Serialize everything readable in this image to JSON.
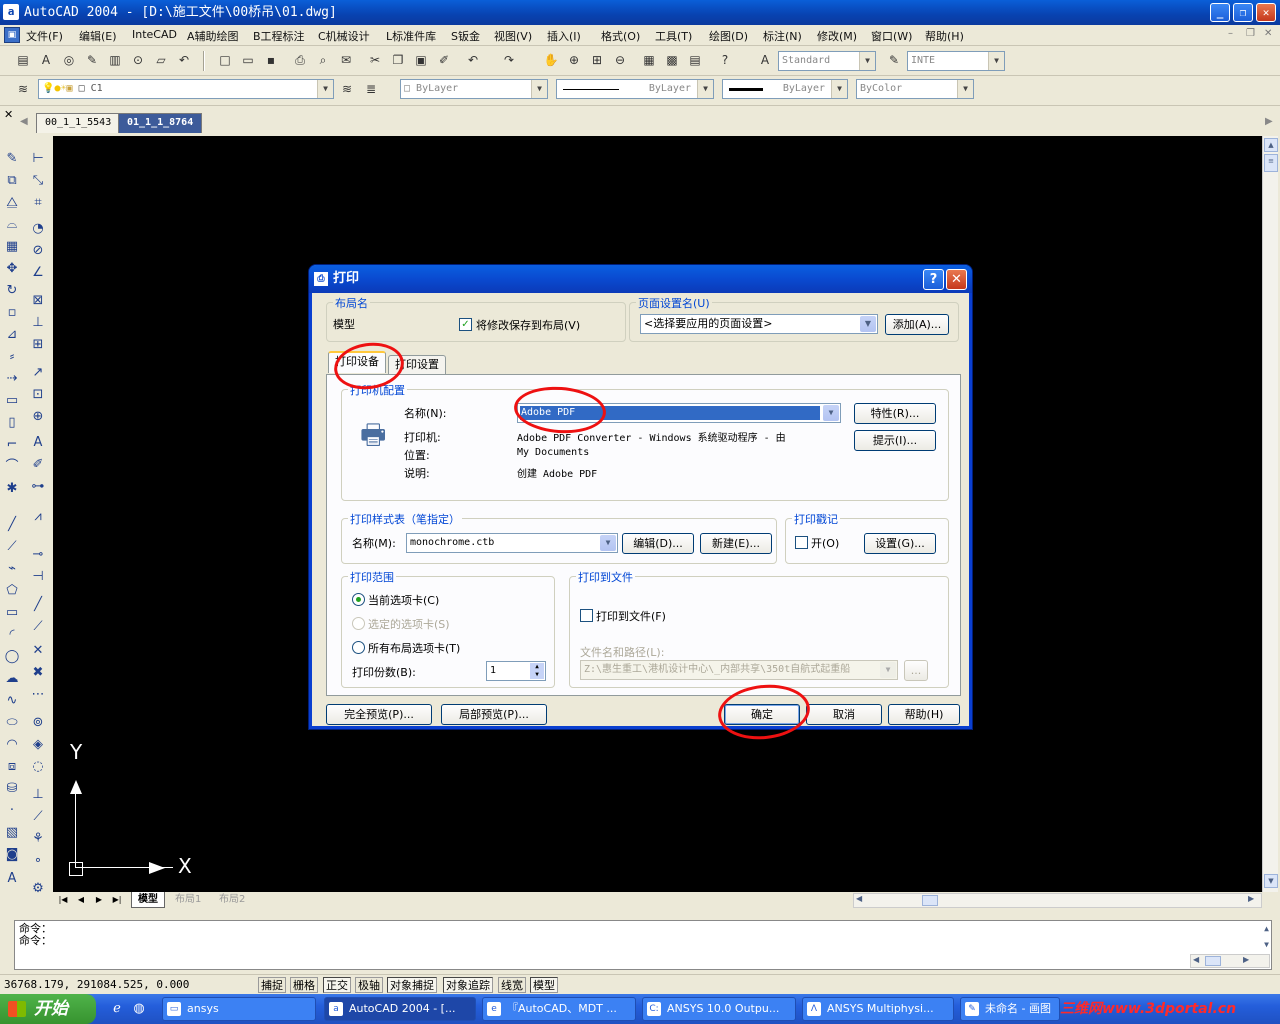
{
  "window": {
    "title": "AutoCAD 2004 - [D:\\施工文件\\00桥吊\\01.dwg]",
    "app_icon": "a",
    "minimize": "_",
    "restore": "❐",
    "close": "✕"
  },
  "menu": {
    "items": [
      "文件(F)",
      "编辑(E)",
      "InteCAD",
      "A辅助绘图",
      "B工程标注",
      "C机械设计",
      "L标准件库",
      "S钣金",
      "视图(V)",
      "插入(I)",
      "格式(O)",
      "工具(T)",
      "绘图(D)",
      "标注(N)",
      "修改(M)",
      "窗口(W)",
      "帮助(H)"
    ],
    "mdi_controls": [
      "–",
      "❐",
      "✕"
    ]
  },
  "toolbar": {
    "textstyle": "Standard",
    "dimstyle": "INTE",
    "layer": "C1",
    "color": "ByLayer",
    "linetype": "ByLayer",
    "lineweight": "ByLayer",
    "plotstyle": "ByColor"
  },
  "doc_tabs": [
    "00_1_1_5543",
    "01_1_1_8764"
  ],
  "layout_tabs": [
    "模型",
    "布局1",
    "布局2"
  ],
  "ucs": {
    "y": "Y",
    "x": "X"
  },
  "command": {
    "line1": "命令：",
    "line2": "命令："
  },
  "status": {
    "coords": "36768.179,  291084.525, 0.000",
    "buttons": [
      "捕捉",
      "栅格",
      "正交",
      "极轴",
      "对象捕捉",
      "对象追踪",
      "线宽",
      "模型"
    ]
  },
  "taskbar": {
    "start": "开始",
    "tasks": [
      "ansys",
      "AutoCAD 2004 - [...",
      "『AutoCAD、MDT ...",
      "ANSYS 10.0 Outpu...",
      "ANSYS Multiphysi...",
      "未命名 - 画图"
    ],
    "watermark": "三维网www.3dportal.cn"
  },
  "dialog": {
    "title": "打印",
    "help_btn": "?",
    "close_btn": "✕",
    "layout_group": "布局名",
    "layout_name": "模型",
    "save_changes_label": "将修改保存到布局(V)",
    "pagesetup_group": "页面设置名(U)",
    "pagesetup_value": "<选择要应用的页面设置>",
    "add_btn": "添加(A)...",
    "tabs": [
      "打印设备",
      "打印设置"
    ],
    "printer_group": "打印机配置",
    "name_label": "名称(N):",
    "printer_name": "Adobe PDF",
    "properties_btn": "特性(R)...",
    "hints_btn": "提示(I)...",
    "printer_label": "打印机:",
    "printer_value": "Adobe PDF Converter - Windows 系统驱动程序 - 由",
    "location_label": "位置:",
    "location_value": "My Documents",
    "desc_label": "说明:",
    "desc_value": "创建 Adobe PDF",
    "plotstyle_group": "打印样式表（笔指定）",
    "ps_name_label": "名称(M):",
    "ps_name_value": "monochrome.ctb",
    "edit_btn": "编辑(D)...",
    "new_btn": "新建(E)...",
    "stamp_group": "打印戳记",
    "stamp_on_label": "开(O)",
    "stamp_settings_btn": "设置(G)...",
    "range_group": "打印范围",
    "range_current": "当前选项卡(C)",
    "range_selected": "选定的选项卡(S)",
    "range_all": "所有布局选项卡(T)",
    "copies_label": "打印份数(B):",
    "copies_value": "1",
    "tofile_group": "打印到文件",
    "tofile_label": "打印到文件(F)",
    "filepath_label": "文件名和路径(L):",
    "filepath_value": "Z:\\惠生重工\\港机设计中心\\_内部共享\\350t自航式起重船",
    "browse_btn": "...",
    "full_preview_btn": "完全预览(P)...",
    "partial_preview_btn": "局部预览(P)...",
    "ok_btn": "确定",
    "cancel_btn": "取消",
    "help_btn2": "帮助(H)"
  }
}
